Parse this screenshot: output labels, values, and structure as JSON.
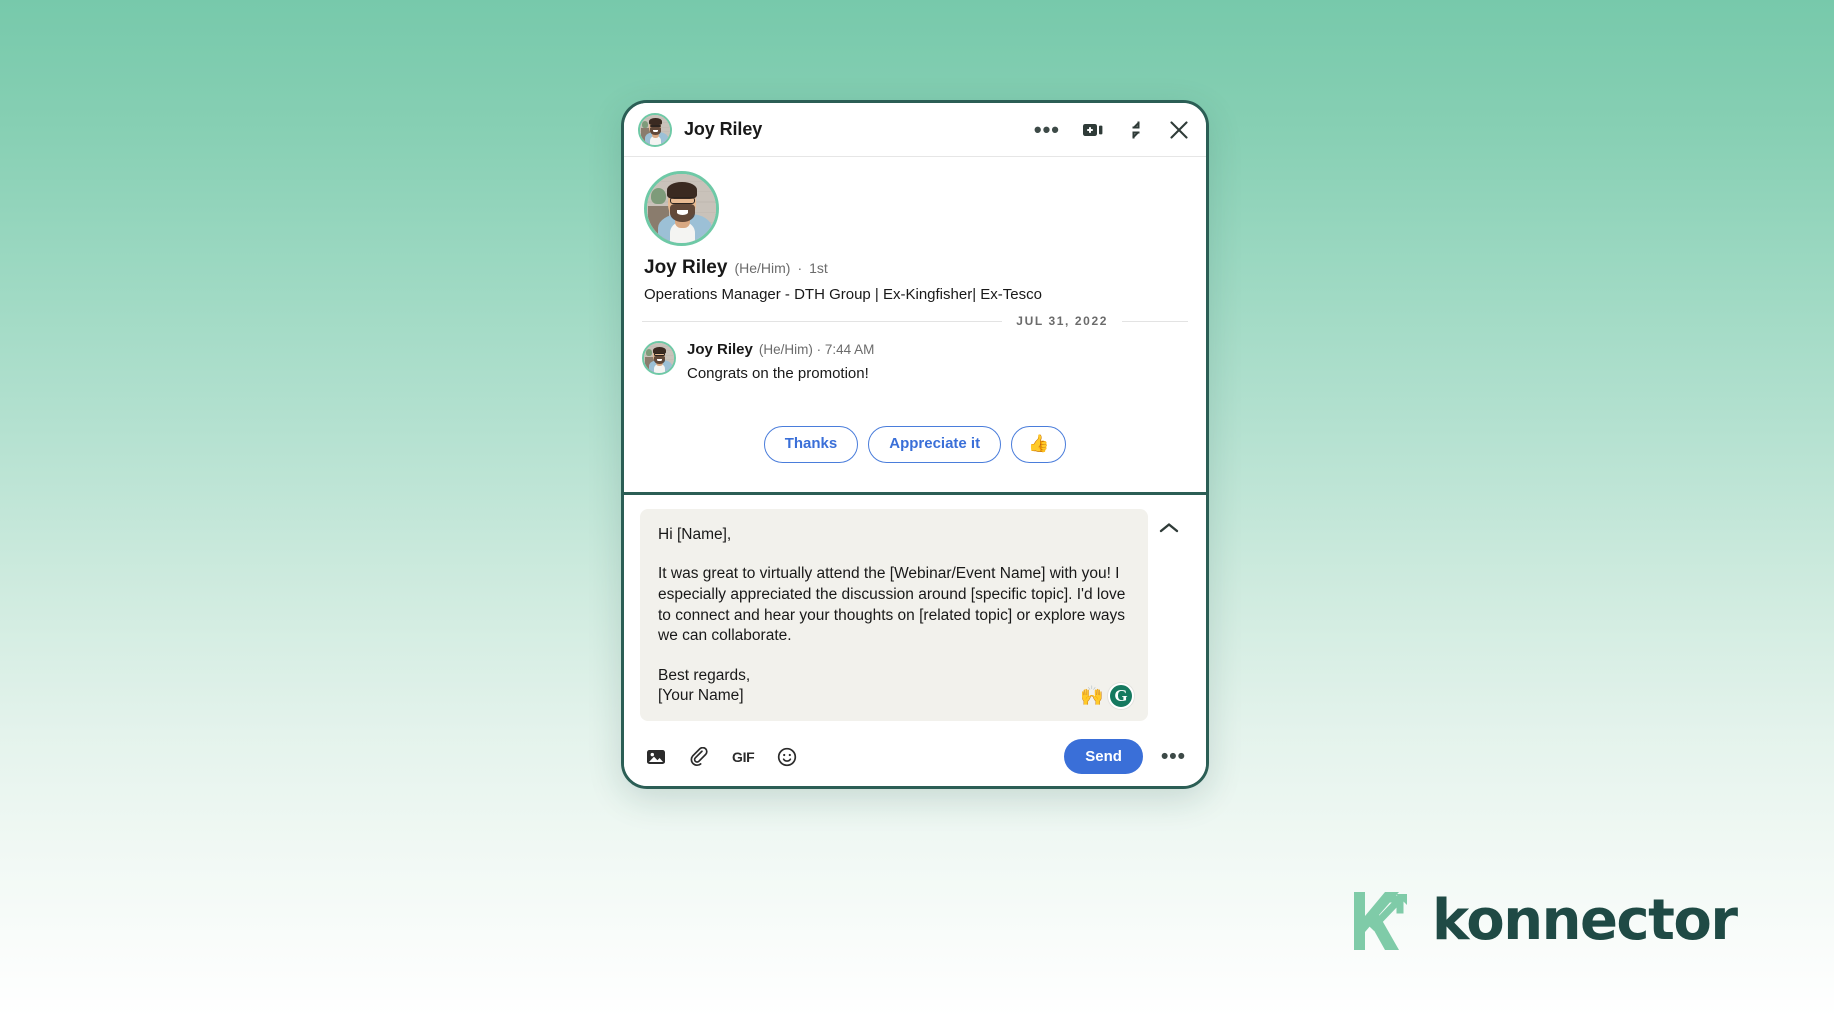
{
  "colors": {
    "background_top": "#77c9ab",
    "background_bottom": "#ffffff",
    "card_border": "#2b5e55",
    "accent_blue": "#3a6fd8",
    "avatar_ring": "#6ec9a6",
    "draft_bg": "#f2f1ec",
    "logo_mark": "#7fcba8",
    "logo_text": "#1f4a45",
    "grammarly_green": "#15795f"
  },
  "header": {
    "title": "Joy Riley",
    "avatar_name": "joy-riley-avatar",
    "actions": [
      {
        "name": "more-options-icon",
        "label": "…"
      },
      {
        "name": "video-call-icon",
        "label": ""
      },
      {
        "name": "collapse-window-icon",
        "label": ""
      },
      {
        "name": "close-icon",
        "label": "✕"
      }
    ]
  },
  "profile": {
    "name": "Joy Riley",
    "pronouns": "(He/Him)",
    "separator": "·",
    "degree": "1st",
    "headline": "Operations Manager - DTH Group | Ex-Kingfisher| Ex-Tesco"
  },
  "conversation": {
    "date_separator": "JUL 31, 2022",
    "messages": [
      {
        "author": "Joy Riley",
        "pronouns": "(He/Him)",
        "time": "7:44 AM",
        "meta": "(He/Him) · 7:44 AM",
        "text": "Congrats on the promotion!"
      }
    ]
  },
  "quick_replies": [
    {
      "name": "quick-reply-thanks",
      "label": "Thanks",
      "type": "text"
    },
    {
      "name": "quick-reply-appreciate-it",
      "label": "Appreciate it",
      "type": "text"
    },
    {
      "name": "quick-reply-thumbs-up",
      "label": "👍",
      "type": "emoji"
    }
  ],
  "composer": {
    "draft": {
      "greeting": "Hi [Name],",
      "body": "It was great to virtually attend the [Webinar/Event Name] with you! I especially appreciated the discussion around [specific topic]. I'd love to connect and hear your thoughts on [related topic] or explore ways we can collaborate.",
      "signoff": "Best regards,",
      "signature": "[Your Name]",
      "badges": [
        {
          "name": "raised-hands-emoji",
          "label": "🙌"
        },
        {
          "name": "grammarly-badge-icon",
          "label": "G"
        }
      ]
    },
    "collapse_icon": "chevron-up-icon",
    "tools": [
      {
        "name": "attach-image-icon",
        "label": "image"
      },
      {
        "name": "attach-file-icon",
        "label": "paperclip"
      },
      {
        "name": "insert-gif-icon",
        "label": "GIF"
      },
      {
        "name": "insert-emoji-icon",
        "label": "emoji"
      }
    ],
    "send_label": "Send",
    "more_label": "…"
  },
  "branding": {
    "wordmark": "konnector",
    "mark_name": "konnector-k-arrow-logo"
  }
}
